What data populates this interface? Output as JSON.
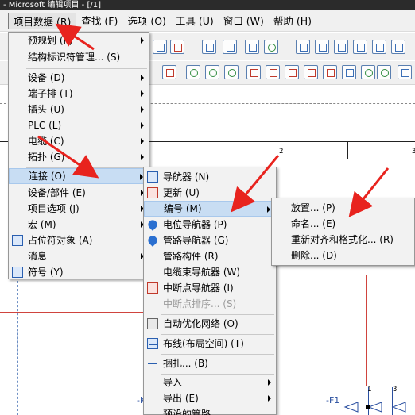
{
  "titlebar": {
    "text": "- Microsoft 编辑项目 - [/1]"
  },
  "menubar": {
    "items": [
      "项目数据 (R)",
      "查找 (F)",
      "选项 (O)",
      "工具 (U)",
      "窗口 (W)",
      "帮助 (H)"
    ]
  },
  "menu_project_data": {
    "items": [
      {
        "label": "预规划 (P)",
        "submenu": true
      },
      {
        "label": "结构标识符管理... (S)",
        "submenu": false
      },
      {
        "label": "设备 (D)",
        "submenu": true
      },
      {
        "label": "端子排 (T)",
        "submenu": true
      },
      {
        "label": "插头 (U)",
        "submenu": true
      },
      {
        "label": "PLC (L)",
        "submenu": true
      },
      {
        "label": "电缆 (C)",
        "submenu": true
      },
      {
        "label": "拓扑 (G)",
        "submenu": true
      },
      {
        "label": "连接 (O)",
        "submenu": true
      },
      {
        "label": "设备/部件 (E)",
        "submenu": true
      },
      {
        "label": "项目选项 (J)",
        "submenu": true
      },
      {
        "label": "宏 (M)",
        "submenu": true
      },
      {
        "label": "占位符对象 (A)",
        "submenu": false
      },
      {
        "label": "消息",
        "submenu": true
      },
      {
        "label": "符号 (Y)",
        "submenu": false
      }
    ]
  },
  "menu_connection": {
    "items": [
      {
        "label": "导航器 (N)"
      },
      {
        "label": "更新 (U)"
      },
      {
        "label": "编号 (M)"
      },
      {
        "label": "电位导航器 (P)"
      },
      {
        "label": "管路导航器 (G)"
      },
      {
        "label": "管路构件 (R)"
      },
      {
        "label": "电缆束导航器 (W)"
      },
      {
        "label": "中断点导航器 (I)"
      },
      {
        "label": "中断点排序... (S)"
      },
      {
        "label": "自动优化网络 (O)"
      },
      {
        "label": "布线(布局空间) (T)"
      },
      {
        "label": "捆扎... (B)"
      },
      {
        "label": "导入"
      },
      {
        "label": "导出 (E)"
      },
      {
        "label": "预设的管路..."
      }
    ]
  },
  "menu_numbering": {
    "items": [
      {
        "label": "放置... (P)"
      },
      {
        "label": "命名... (E)"
      },
      {
        "label": "重新对齐和格式化... (R)"
      },
      {
        "label": "删除... (D)"
      }
    ]
  },
  "canvas": {
    "col_labels": [
      "2",
      "3"
    ],
    "tag_k": "-K",
    "tag_f": "-F1",
    "pin_1": "1",
    "pin_3": "3"
  },
  "colors": {
    "annotation_arrow": "#e8231e",
    "highlight": "#c8ddf3",
    "wire": "#d0443e"
  }
}
